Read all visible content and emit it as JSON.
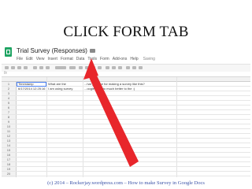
{
  "caption": "CLICK FORM TAB",
  "app": {
    "icon": "sheets-icon",
    "title": "Trial Survey (Responses)",
    "star_icon": "star-icon",
    "folder_icon": "folder-icon"
  },
  "menu": {
    "items": [
      "File",
      "Edit",
      "View",
      "Insert",
      "Format",
      "Data",
      "Tools",
      "Form",
      "Add-ons",
      "Help"
    ],
    "status": "Saving"
  },
  "sheet": {
    "headers": [
      "Timestamp",
      "What are the",
      "...hat you use for making a survey like this?"
    ],
    "rows": [
      [
        "6/17/2014 12:25:16",
        "I am using survey",
        "...oogle docs to much better to the :)"
      ]
    ],
    "row_numbers": [
      "1",
      "2",
      "3",
      "4",
      "5",
      "6",
      "7",
      "8",
      "9",
      "10",
      "11",
      "12",
      "13",
      "14",
      "15",
      "16",
      "17",
      "18",
      "19",
      "20"
    ]
  },
  "accent_colors": {
    "arrow": "#e8262b",
    "footer_text": "#3a52a8",
    "selection": "#4a7ff0"
  },
  "footer": "(c) 2014 – Rockerjay.wordpress.com – How to make Survey in Google Docs"
}
